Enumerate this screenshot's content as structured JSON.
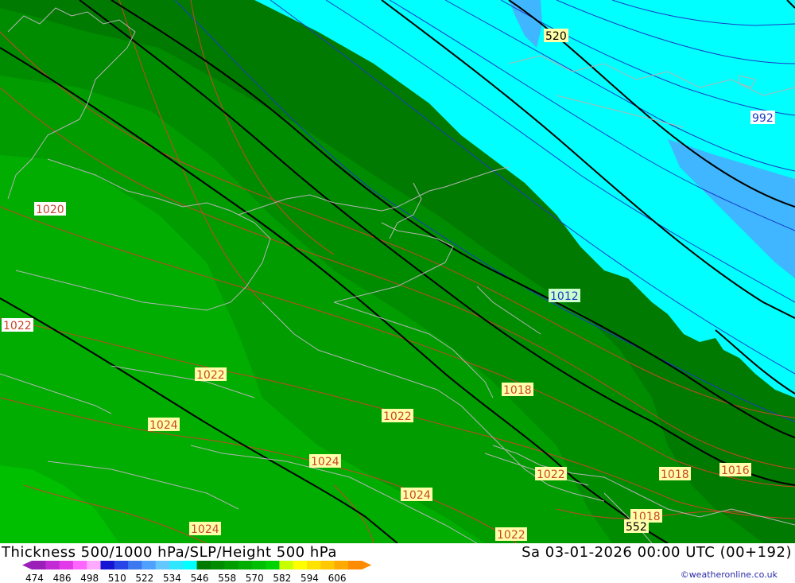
{
  "map": {
    "colors": {
      "dark_green": "#007a00",
      "mid_green": "#008c00",
      "green_546": "#009c00",
      "green_552": "#00ad00",
      "green_558": "#00be00",
      "cyan_528": "#00ffff",
      "blue_522": "#3fb6ff",
      "slp_isobar": "#c84628",
      "slp_isobar_low": "#1a3cc8",
      "height_contour": "#000000",
      "coastline": "#b4b4b4"
    },
    "isobar_labels": [
      {
        "id": "520",
        "text": "520",
        "kind": "height"
      },
      {
        "id": "992",
        "text": "992",
        "kind": "slp-low"
      },
      {
        "id": "1020",
        "text": "1020",
        "kind": "slp"
      },
      {
        "id": "1022a",
        "text": "1022",
        "kind": "slp"
      },
      {
        "id": "1012",
        "text": "1012",
        "kind": "slp-low"
      },
      {
        "id": "1022b",
        "text": "1022",
        "kind": "slp"
      },
      {
        "id": "1018a",
        "text": "1018",
        "kind": "slp"
      },
      {
        "id": "1024a",
        "text": "1024",
        "kind": "slp"
      },
      {
        "id": "1022c",
        "text": "1022",
        "kind": "slp"
      },
      {
        "id": "1024b",
        "text": "1024",
        "kind": "slp"
      },
      {
        "id": "1024c",
        "text": "1024",
        "kind": "slp"
      },
      {
        "id": "1022d",
        "text": "1022",
        "kind": "slp"
      },
      {
        "id": "1018b",
        "text": "1018",
        "kind": "slp"
      },
      {
        "id": "1016",
        "text": "1016",
        "kind": "slp"
      },
      {
        "id": "1018c",
        "text": "1018",
        "kind": "slp"
      },
      {
        "id": "552",
        "text": "552",
        "kind": "height"
      },
      {
        "id": "1024d",
        "text": "1024",
        "kind": "slp"
      },
      {
        "id": "1022e",
        "text": "1022",
        "kind": "slp"
      }
    ]
  },
  "footer": {
    "title_left": "Thickness 500/1000 hPa/SLP/Height 500 hPa",
    "title_right": "Sa 03-01-2026 00:00 UTC (00+192)",
    "credit": "©weatheronline.co.uk",
    "legend": {
      "ticks": [
        "474",
        "486",
        "498",
        "510",
        "522",
        "534",
        "546",
        "558",
        "570",
        "582",
        "594",
        "606"
      ],
      "colors": [
        "#9a1fb8",
        "#c22ad6",
        "#e23ae8",
        "#ff66ff",
        "#ffaaff",
        "#1414d2",
        "#2846e6",
        "#3c78f0",
        "#50a0ff",
        "#64c8ff",
        "#30e6ff",
        "#00ffff",
        "#007a00",
        "#008c00",
        "#009c00",
        "#00ad00",
        "#00be00",
        "#00d200",
        "#c8ff00",
        "#ffff00",
        "#ffe200",
        "#ffc800",
        "#ffaa00",
        "#ff8c00"
      ]
    }
  }
}
